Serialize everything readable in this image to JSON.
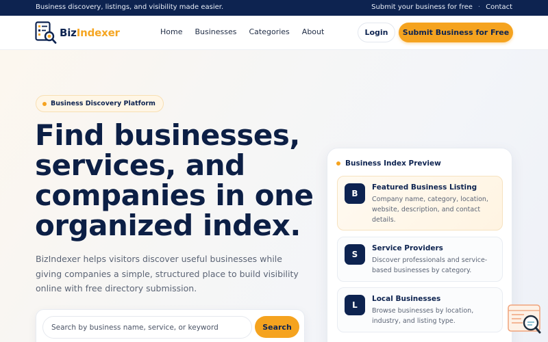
{
  "topbar": {
    "tagline": "Business discovery, listings, and visibility made easier.",
    "links": [
      "Submit your business for free",
      "Contact"
    ],
    "separator": "·"
  },
  "header": {
    "logo": {
      "part1": "Biz",
      "part2": "Indexer"
    },
    "nav": [
      "Home",
      "Businesses",
      "Categories",
      "About"
    ],
    "login_label": "Login",
    "submit_label": "Submit Business for Free"
  },
  "hero": {
    "pill": "Business Discovery Platform",
    "headline": "Find businesses, services, and companies in one organized index.",
    "subtext": "BizIndexer helps visitors discover useful businesses while giving companies a simple, structured place to build visibility online with free directory submission.",
    "search": {
      "placeholder": "Search by business name, service, or keyword",
      "button": "Search"
    }
  },
  "preview": {
    "title": "Business Index Preview",
    "cards": [
      {
        "badge": "B",
        "title": "Featured Business Listing",
        "desc": "Company name, category, location, website, description, and contact details."
      },
      {
        "badge": "S",
        "title": "Service Providers",
        "desc": "Discover professionals and service-based businesses by category."
      },
      {
        "badge": "L",
        "title": "Local Businesses",
        "desc": "Browse businesses by location, industry, and listing type."
      }
    ]
  },
  "colors": {
    "navy": "#0d2350",
    "accent": "#f5a31f",
    "muted_text": "#5b6475"
  },
  "icons": {
    "logo": "index-magnifier-icon",
    "help_widget": "search-help-icon"
  }
}
